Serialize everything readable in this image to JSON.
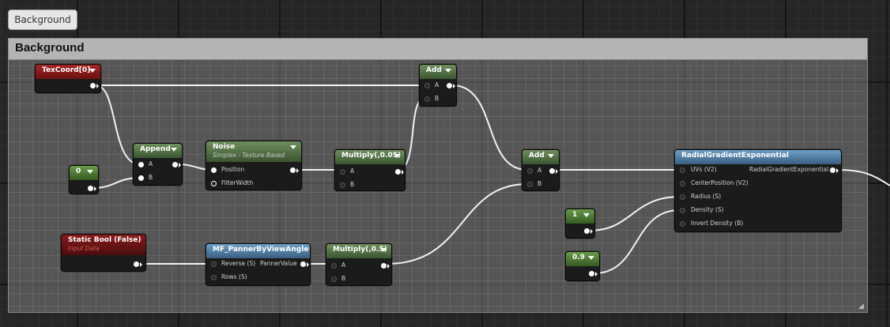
{
  "tab": {
    "label": "Background"
  },
  "comment": {
    "title": "Background"
  },
  "nodes": {
    "texcoord": {
      "title": "TexCoord[0]"
    },
    "append": {
      "title": "Append",
      "in_a": "A",
      "in_b": "B"
    },
    "const0": {
      "title": "0"
    },
    "noise": {
      "title": "Noise",
      "subtitle": "Simplex - Texture Based",
      "in_position": "Position",
      "in_filterwidth": "FilterWidth"
    },
    "multiply005": {
      "title": "Multiply(,0.05)",
      "in_a": "A",
      "in_b": "B"
    },
    "add1": {
      "title": "Add",
      "in_a": "A",
      "in_b": "B"
    },
    "add2": {
      "title": "Add",
      "in_a": "A",
      "in_b": "B"
    },
    "staticbool": {
      "title": "Static Bool (False)",
      "subtitle": "Input Data"
    },
    "panner": {
      "title": "MF_PannerByViewAngle",
      "in_reverse": "Reverse (S)",
      "out_panner": "PannerValue",
      "in_rows": "Rows (S)"
    },
    "multiply05": {
      "title": "Multiply(,0.5)",
      "in_a": "A",
      "in_b": "B"
    },
    "const1": {
      "title": "1"
    },
    "const09": {
      "title": "0.9"
    },
    "radial": {
      "title": "RadialGradientExponential",
      "in_uvs": "UVs (V2)",
      "out_main": "RadialGradientExponential",
      "in_center": "CenterPosition (V2)",
      "in_radius": "Radius (S)",
      "in_density": "Density (S)",
      "in_invert": "Invert Density (B)"
    }
  }
}
